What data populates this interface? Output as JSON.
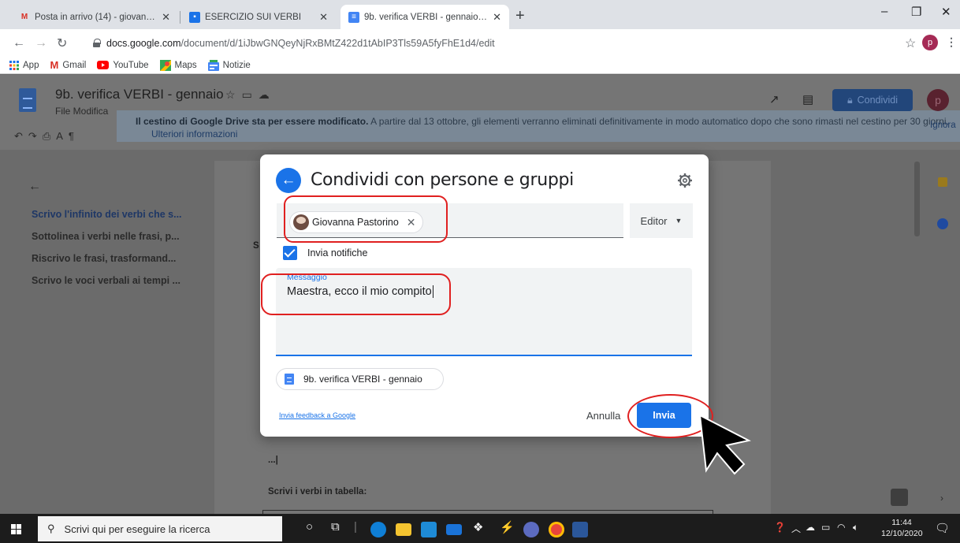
{
  "browser": {
    "tabs": [
      {
        "label": "Posta in arrivo (14) - giovanna.pa",
        "icon": "gmail-icon"
      },
      {
        "label": "ESERCIZIO SUI VERBI",
        "icon": "classroom-icon"
      },
      {
        "label": "9b. verifica VERBI - gennaio - Do",
        "icon": "docs-icon"
      }
    ],
    "new_tab": "+",
    "url_host": "docs.google.com",
    "url_path": "/document/d/1iJbwGNQeyNjRxBMtZ422d1tAbIP3Tls59A5fyFhE1d4/edit",
    "profile_initial": "p",
    "bookmarks": [
      {
        "label": "App",
        "icon": "apps-grid-icon"
      },
      {
        "label": "Gmail",
        "icon": "gmail-icon"
      },
      {
        "label": "YouTube",
        "icon": "youtube-icon"
      },
      {
        "label": "Maps",
        "icon": "maps-icon"
      },
      {
        "label": "Notizie",
        "icon": "news-icon"
      }
    ]
  },
  "docs": {
    "title": "9b. verifica VERBI - gennaio",
    "menu": "File  Modifica",
    "banner_bold": "Il cestino di Google Drive sta per essere modificato.",
    "banner_text": "A partire dal 13 ottobre, gli elementi verranno eliminati definitivamente in modo automatico dopo che sono rimasti nel cestino per 30 giorni.",
    "banner_link": "Ulteriori informazioni",
    "banner_dismiss": "Ignora",
    "share_label": "Condividi",
    "avatar_initial": "p",
    "outline": [
      "Scrivo l'infinito dei verbi che s...",
      "Sottolinea i verbi nelle frasi, p...",
      "Riscrivo le frasi, trasformand...",
      "Scrivo le voci verbali ai tempi ..."
    ],
    "page_s": "S",
    "page_dots": "...|",
    "page_heading": "Scrivi i verbi in tabella:"
  },
  "dialog": {
    "title": "Condividi con persone e gruppi",
    "recipient": "Giovanna Pastorino",
    "role": "Editor",
    "notify_label": "Invia notifiche",
    "notify_checked": true,
    "message_label": "Messaggio",
    "message_value": "Maestra, ecco il mio compito",
    "doc_chip": "9b. verifica VERBI - gennaio",
    "feedback": "Invia feedback a Google",
    "cancel": "Annulla",
    "send": "Invia"
  },
  "taskbar": {
    "search_placeholder": "Scrivi qui per eseguire la ricerca",
    "time": "11:44",
    "date": "12/10/2020"
  },
  "colors": {
    "accent": "#1a73e8",
    "highlight": "#e02020"
  }
}
